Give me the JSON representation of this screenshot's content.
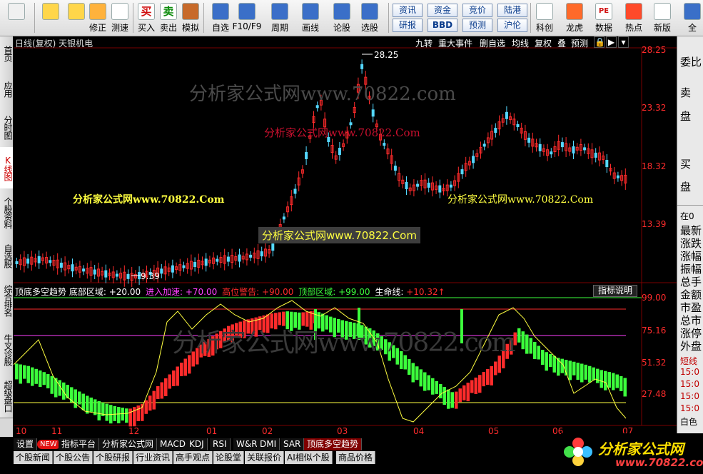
{
  "toolbar": {
    "buttons": [
      {
        "label": "",
        "icon": "windows-icon"
      },
      {
        "label": "",
        "icon": "back-arrow-icon"
      },
      {
        "label": "",
        "icon": "up-down-arrows-icon"
      },
      {
        "label": "修正",
        "icon": "fix-icon"
      },
      {
        "label": "测速",
        "icon": "clock-icon"
      },
      {
        "label": "买入",
        "icon": "buy-icon",
        "glyph": "买"
      },
      {
        "label": "卖出",
        "icon": "sell-icon",
        "glyph": "卖"
      },
      {
        "label": "模拟",
        "icon": "hammer-icon"
      },
      {
        "label": "自选",
        "icon": "star-icon"
      },
      {
        "label": "F10/F9",
        "icon": "f10-icon"
      },
      {
        "label": "周期",
        "icon": "cycle-icon"
      },
      {
        "label": "画线",
        "icon": "pencil-icon"
      },
      {
        "label": "论股",
        "icon": "discuss-icon"
      },
      {
        "label": "选股",
        "icon": "select-stock-icon"
      },
      {
        "label": "科创",
        "icon": "chart-thumb-icon"
      },
      {
        "label": "龙虎",
        "icon": "dragon-icon"
      },
      {
        "label": "数据",
        "icon": "pe-icon",
        "glyph": "PE"
      },
      {
        "label": "热点",
        "icon": "hot-icon"
      },
      {
        "label": "新版",
        "icon": "window-icon"
      },
      {
        "label": "全",
        "icon": "globe-icon"
      }
    ],
    "chips": [
      "资讯",
      "资金",
      "竞价",
      "陆港",
      "研报",
      "BBD",
      "预测",
      "沪伦"
    ]
  },
  "left_tabs": [
    "首页",
    "应用",
    "分时图",
    "K线图",
    "个股资料",
    "自选股",
    "综合排名",
    "牛叉诊股",
    "超级盘口"
  ],
  "header": {
    "title": "日线(复权) 天银机电",
    "buttons": [
      "九转",
      "重大事件",
      "删自选",
      "均线",
      "复权",
      "叠",
      "预测"
    ]
  },
  "price_axis": [
    "28.25",
    "23.32",
    "18.32",
    "13.39"
  ],
  "annotations": {
    "high": "28.25",
    "low": "9.39"
  },
  "watermarks": {
    "large": "分析家公式网www.70822.com",
    "small_red": "分析家公式网www.70822.Com",
    "yellow_left": "分析家公式网www.70822.Com",
    "yellow_right": "分析家公式网www.70822.Com",
    "boxed": "分析家公式网www.70822.Com",
    "lower": "分析家公式网www.70822.com"
  },
  "indicator": {
    "name": "顶底多空趋势",
    "bottom_label": "底部区域:",
    "bottom_value": "+20.00",
    "accel_label": "进入加速:",
    "accel_value": "+70.00",
    "warn_label": "高位警告:",
    "warn_value": "+90.00",
    "top_label": "顶部区域:",
    "top_value": "+99.00",
    "life_label": "生命线:",
    "life_value": "+10.32↑",
    "help": "指标说明",
    "axis": [
      "99.00",
      "75.16",
      "51.32",
      "27.48"
    ]
  },
  "x_axis": [
    "10",
    "11",
    "12",
    "01",
    "02",
    "03",
    "04",
    "05",
    "06",
    "07"
  ],
  "right_panel": {
    "big": [
      "委比",
      "卖",
      "盘",
      "买",
      "盘"
    ],
    "items": [
      "在0",
      "最新",
      "涨跌",
      "涨幅",
      "振幅",
      "总手",
      "金额",
      "市盈",
      "总市",
      "涨停",
      "外盘",
      "短线",
      "15:0",
      "15:0",
      "15:0",
      "15:0",
      "白色"
    ]
  },
  "bottom_tabs": [
    "设置",
    "NEW",
    "指标平台",
    "分析家公式网",
    "MACD",
    "KDJ",
    "RSI",
    "W&R",
    "DMI",
    "SAR",
    "顶底多空趋势"
  ],
  "sub_tabs": [
    "个股新闻",
    "个股公告",
    "个股研报",
    "行业资讯",
    "高手观点",
    "论股堂",
    "关联报价",
    "AI相似个股",
    "商品价格"
  ],
  "logo": {
    "text": "分析家公式网",
    "url": "www.70822.com"
  },
  "colors": {
    "up": "#ff2b2b",
    "down": "#54d8ff",
    "green": "#3cff3c",
    "yellow": "#ffff40",
    "purple": "#ff40ff"
  }
}
